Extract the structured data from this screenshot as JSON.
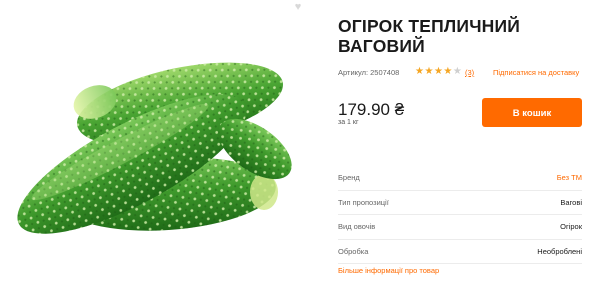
{
  "product": {
    "title": "Огірок тепличний ваговий",
    "sku": "Артикул: 2507408",
    "rating": 4,
    "rating_max": 5,
    "reviews": "(3)",
    "subscribe_label": "Підписатися на доставку",
    "price": "179.90 ₴",
    "unit": "за 1 кг",
    "cart_label": "В кошик",
    "image_icon": "cucumber-photo",
    "heart_icon": "heart-icon"
  },
  "properties": [
    {
      "label": "Бренд",
      "value": "Без ТМ",
      "link": true
    },
    {
      "label": "Тип пропозиції",
      "value": "Вагові",
      "link": false
    },
    {
      "label": "Вид овочів",
      "value": "Огірок",
      "link": false
    },
    {
      "label": "Обробка",
      "value": "Необроблені",
      "link": false
    }
  ],
  "more_info_label": "Більше інформації про товар",
  "colors": {
    "accent": "#ff6a00",
    "star": "#f5a623",
    "cucumber": "#3e9a2b"
  }
}
